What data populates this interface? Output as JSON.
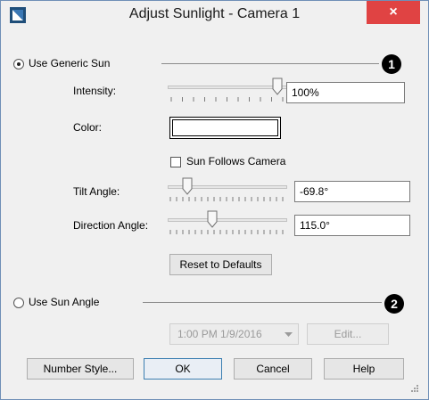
{
  "window": {
    "title": "Adjust Sunlight - Camera 1",
    "close_glyph": "×"
  },
  "generic_sun": {
    "label": "Use Generic Sun",
    "selected": true,
    "callout": "1"
  },
  "intensity": {
    "label": "Intensity:",
    "value": "100%",
    "slider_fraction": 1.0
  },
  "color": {
    "label": "Color:",
    "swatch": "#ffffff"
  },
  "sun_follows_camera": {
    "label": "Sun Follows Camera",
    "checked": false
  },
  "tilt_angle": {
    "label": "Tilt Angle:",
    "value": "-69.8°",
    "slider_fraction": 0.12
  },
  "direction_angle": {
    "label": "Direction Angle:",
    "value": "115.0°",
    "slider_fraction": 0.32
  },
  "reset_button": {
    "label": "Reset to Defaults"
  },
  "sun_angle": {
    "label": "Use Sun Angle",
    "selected": false,
    "callout": "2",
    "datetime": "1:00 PM 1/9/2016",
    "edit_label": "Edit..."
  },
  "footer": {
    "number_style": "Number Style...",
    "ok": "OK",
    "cancel": "Cancel",
    "help": "Help"
  },
  "icons": [
    "app-icon",
    "close-icon",
    "chevron-down-icon",
    "resize-grip-icon"
  ],
  "colors": {
    "close": "#e04343",
    "accent": "#3c7fb1"
  }
}
